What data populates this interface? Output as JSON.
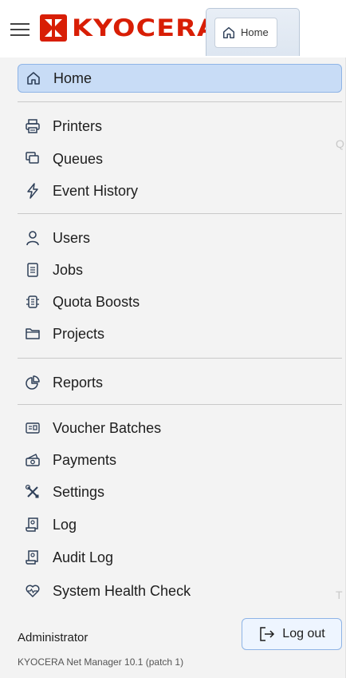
{
  "header": {
    "logo_text": "KYOCERA",
    "tab_label": "Home",
    "brand_color": "#d81e05"
  },
  "menu": {
    "home": "Home",
    "printers": "Printers",
    "queues": "Queues",
    "event_history": "Event History",
    "users": "Users",
    "jobs": "Jobs",
    "quota_boosts": "Quota Boosts",
    "projects": "Projects",
    "reports": "Reports",
    "voucher_batches": "Voucher Batches",
    "payments": "Payments",
    "settings": "Settings",
    "log": "Log",
    "audit_log": "Audit Log",
    "system_health_check": "System Health Check"
  },
  "footer": {
    "user": "Administrator",
    "logout_label": "Log out",
    "version": "KYOCERA Net Manager 10.1 (patch 1)"
  },
  "icons": {
    "menu": "hamburger-icon",
    "home": "home-icon",
    "printers": "printer-icon",
    "queues": "queues-icon",
    "event_history": "lightning-icon",
    "users": "user-icon",
    "jobs": "document-icon",
    "quota_boosts": "quota-icon",
    "projects": "folder-icon",
    "reports": "pie-chart-icon",
    "voucher_batches": "voucher-icon",
    "payments": "payment-icon",
    "settings": "tools-icon",
    "log": "log-icon",
    "audit_log": "audit-log-icon",
    "system_health_check": "heart-icon",
    "logout": "logout-icon"
  },
  "colors": {
    "active_bg": "#c8dcf6",
    "active_border": "#8eb4e6",
    "icon": "#2e3f58"
  }
}
